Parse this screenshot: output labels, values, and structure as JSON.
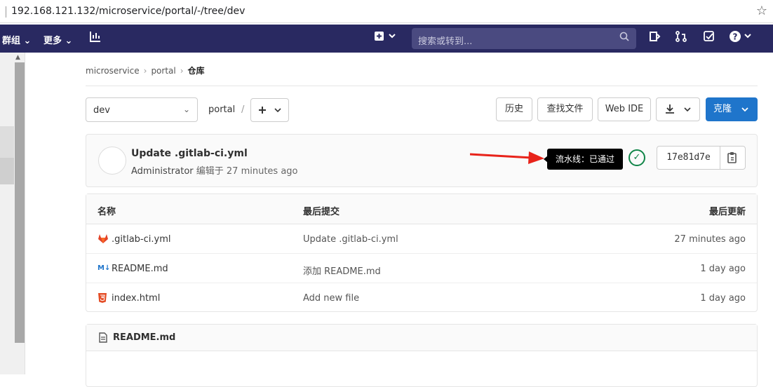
{
  "browser": {
    "url": "192.168.121.132/microservice/portal/-/tree/dev"
  },
  "topnav": {
    "groups": "群组",
    "more": "更多",
    "search_placeholder": "搜索或转到..."
  },
  "breadcrumb": {
    "items": [
      "microservice",
      "portal",
      "仓库"
    ]
  },
  "toolbar": {
    "branch": "dev",
    "path": "portal",
    "path_sep": "/",
    "history": "历史",
    "find_file": "查找文件",
    "web_ide": "Web IDE",
    "clone": "克隆"
  },
  "commit": {
    "title": "Update .gitlab-ci.yml",
    "author": "Administrator",
    "meta": "编辑于 27 minutes ago",
    "tooltip": "流水线：已通过",
    "sha": "17e81d7e",
    "status_color": "#108548"
  },
  "table": {
    "headers": [
      "名称",
      "最后提交",
      "最后更新"
    ],
    "rows": [
      {
        "name": ".gitlab-ci.yml",
        "icon": "gitlab-icon",
        "message": "Update .gitlab-ci.yml",
        "updated": "27 minutes ago"
      },
      {
        "name": "README.md",
        "icon": "markdown-icon",
        "message": "添加 README.md",
        "updated": "1 day ago"
      },
      {
        "name": "index.html",
        "icon": "html5-icon",
        "message": "Add new file",
        "updated": "1 day ago"
      }
    ]
  },
  "readme": {
    "title": "README.md"
  },
  "colors": {
    "nav": "#292961",
    "accent": "#1f75cb",
    "arrow": "#e8231a"
  }
}
